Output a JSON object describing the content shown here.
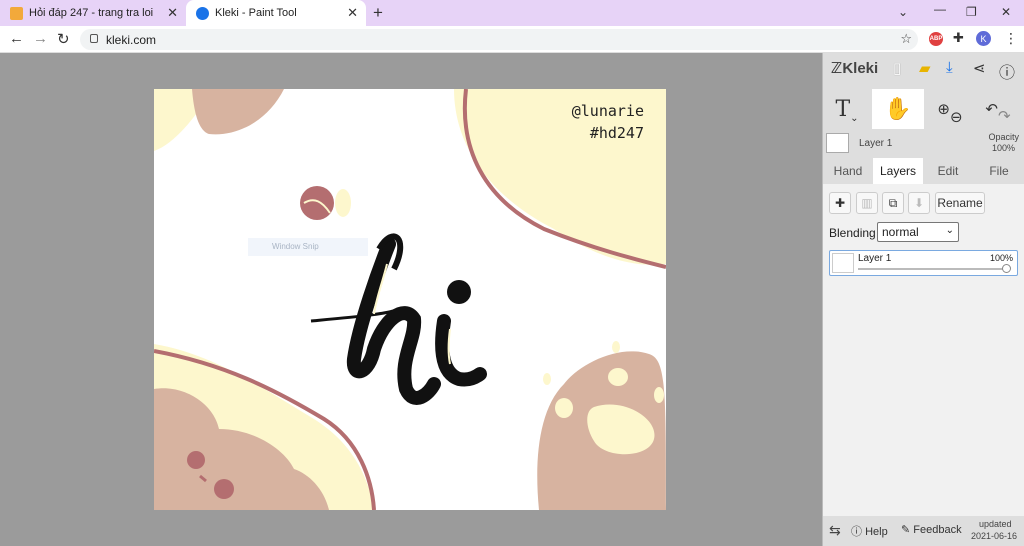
{
  "browser": {
    "tabs": [
      {
        "title": "Hỏi đáp 247 - trang tra loi",
        "favicon_color": "#f2a93b"
      },
      {
        "title": "Kleki - Paint Tool",
        "favicon_color": "#1a73e8"
      }
    ],
    "url": "kleki.com",
    "profile_initial": "K",
    "abp_label": "ABP"
  },
  "canvas": {
    "watermark_line1": "@lunarie",
    "watermark_line2": "#hd247",
    "overlay_text": "Window Snip",
    "colors": {
      "cream": "#fdf7cd",
      "tan": "#d7b3a0",
      "rose": "#b46e70",
      "ink": "#111111"
    }
  },
  "sidebar": {
    "logo": "Kleki",
    "layer_name": "Layer 1",
    "opacity_label": "Opacity",
    "opacity_value": "100%",
    "tabs": [
      "Hand",
      "Layers",
      "Edit",
      "File"
    ],
    "active_tab": "Layers",
    "rename_label": "Rename",
    "blending_label": "Blending",
    "blending_value": "normal",
    "layers": [
      {
        "name": "Layer 1",
        "opacity": "100%"
      }
    ],
    "footer": {
      "help": "Help",
      "feedback": "Feedback",
      "updated_label": "updated",
      "updated_date": "2021-06-16"
    }
  }
}
